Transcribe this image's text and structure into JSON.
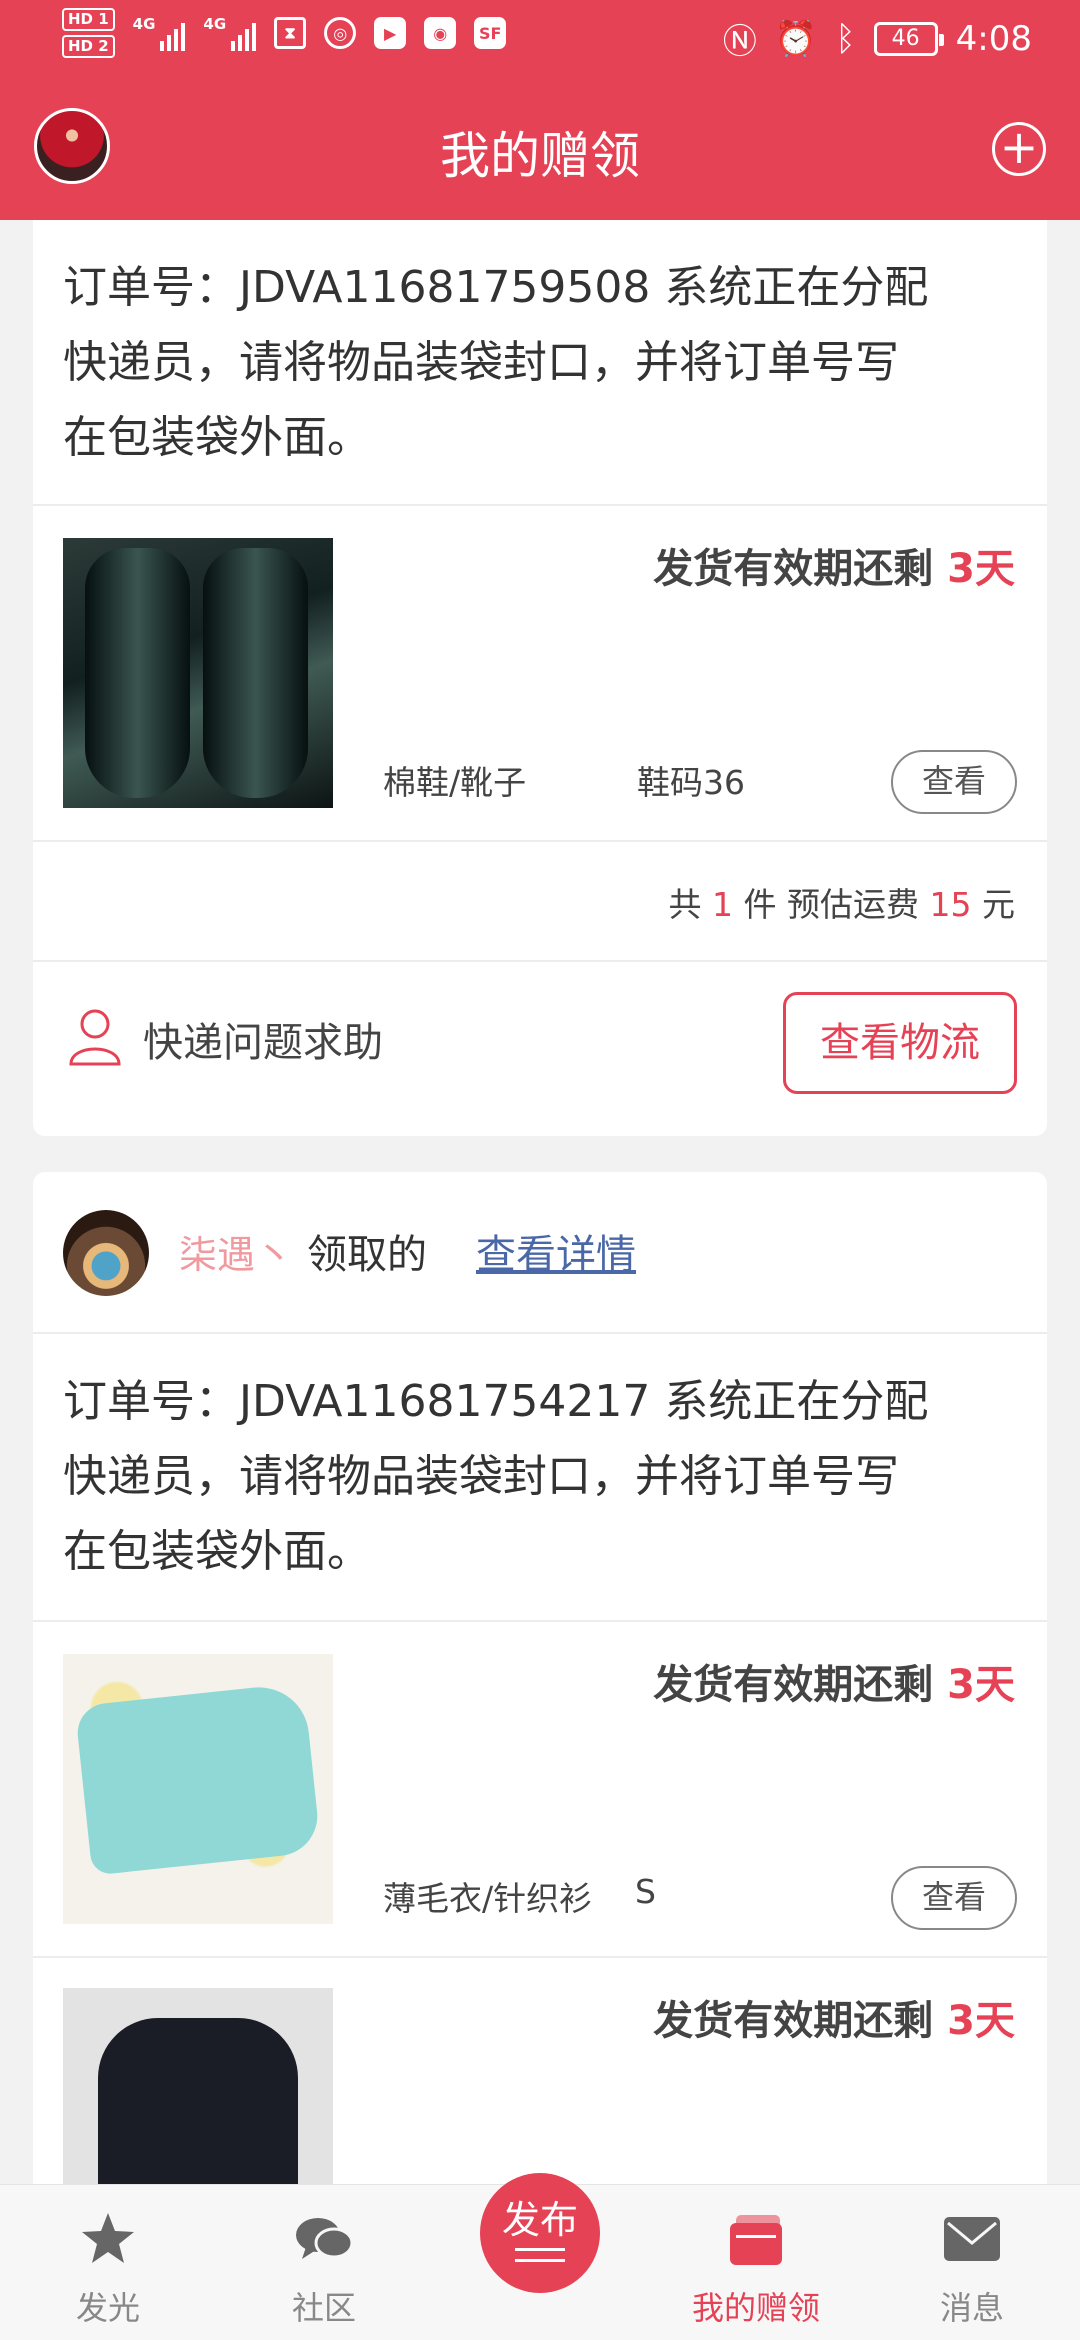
{
  "status_bar": {
    "hd1": "HD 1",
    "hd2": "HD 2",
    "net1": "4G",
    "net2": "4G",
    "icons": [
      "hourglass-icon",
      "globe-icon",
      "play-app-icon",
      "bulb-app-icon",
      "sf-app-icon",
      "nfc-icon",
      "alarm-icon",
      "bluetooth-icon"
    ],
    "sf_label": "SF",
    "battery": "46",
    "time": "4:08"
  },
  "header": {
    "title": "我的赠领",
    "add_icon": "plus-circle-icon",
    "avatar_icon": "user-avatar"
  },
  "card1": {
    "order_line1": "订单号：JDVA11681759508 系统正在分配",
    "order_line2": "快递员，请将物品装袋封口，并将订单号写",
    "order_line3": "在包装袋外面。",
    "item": {
      "expiry_prefix": "发货有效期还剩",
      "expiry_days": "3天",
      "category": "棉鞋/靴子",
      "size": "鞋码36",
      "view": "查看"
    },
    "summary": {
      "p1": "共",
      "count": "1",
      "p2": "件 预估运费",
      "fee": "15",
      "p3": "元"
    },
    "help_label": "快递问题求助",
    "logistics_button": "查看物流"
  },
  "card2": {
    "user_name": "柒遇丶",
    "claimed_text": "领取的",
    "details_link": "查看详情",
    "order_line1": "订单号：JDVA11681754217 系统正在分配",
    "order_line2": "快递员，请将物品装袋封口，并将订单号写",
    "order_line3": "在包装袋外面。",
    "items": [
      {
        "expiry_prefix": "发货有效期还剩",
        "expiry_days": "3天",
        "category": "薄毛衣/针织衫",
        "size": "S",
        "view": "查看"
      },
      {
        "expiry_prefix": "发货有效期还剩",
        "expiry_days": "3天"
      }
    ]
  },
  "tabbar": {
    "tabs": [
      {
        "label": "发光",
        "icon": "star-icon"
      },
      {
        "label": "社区",
        "icon": "chat-bubbles-icon"
      },
      {
        "label": "发布",
        "icon": "publish-icon"
      },
      {
        "label": "我的赠领",
        "icon": "wallet-icon"
      },
      {
        "label": "消息",
        "icon": "envelope-icon"
      }
    ],
    "active_index": 3,
    "accent_color": "#e54255"
  }
}
